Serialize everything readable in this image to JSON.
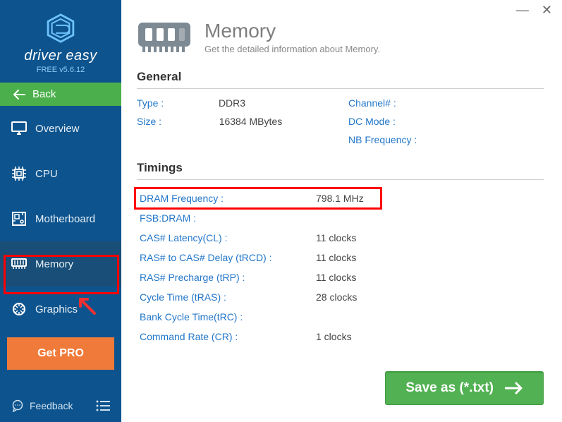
{
  "brand": {
    "name": "driver easy",
    "version": "FREE v5.6.12"
  },
  "back_label": "Back",
  "nav": {
    "overview": "Overview",
    "cpu": "CPU",
    "motherboard": "Motherboard",
    "memory": "Memory",
    "graphics": "Graphics"
  },
  "get_pro": "Get PRO",
  "feedback": "Feedback",
  "page": {
    "title": "Memory",
    "subtitle": "Get the detailed information about Memory."
  },
  "general": {
    "heading": "General",
    "type_label": "Type :",
    "type_value": "DDR3",
    "size_label": "Size :",
    "size_value": "16384 MBytes",
    "channel_label": "Channel# :",
    "channel_value": "",
    "dcmode_label": "DC Mode :",
    "dcmode_value": "",
    "nbfreq_label": "NB Frequency :",
    "nbfreq_value": ""
  },
  "timings": {
    "heading": "Timings",
    "rows": {
      "dram_freq": {
        "label": "DRAM Frequency :",
        "value": "798.1 MHz"
      },
      "fsb_dram": {
        "label": "FSB:DRAM :",
        "value": ""
      },
      "cas": {
        "label": "CAS# Latency(CL) :",
        "value": "11 clocks"
      },
      "trcd": {
        "label": "RAS# to CAS# Delay (tRCD) :",
        "value": "11 clocks"
      },
      "trp": {
        "label": "RAS# Precharge (tRP) :",
        "value": "11 clocks"
      },
      "tras": {
        "label": "Cycle Time (tRAS) :",
        "value": "28 clocks"
      },
      "trc": {
        "label": "Bank Cycle Time(tRC) :",
        "value": ""
      },
      "cr": {
        "label": "Command Rate (CR) :",
        "value": "1 clocks"
      }
    }
  },
  "save_label": "Save as (*.txt)",
  "window_controls": {
    "minimize": "—",
    "close": "✕"
  }
}
